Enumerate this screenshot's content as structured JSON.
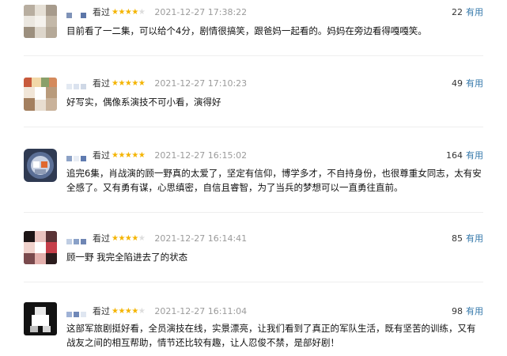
{
  "ui": {
    "watched_label": "看过",
    "useful_label": "有用"
  },
  "colors": {
    "star": "#f4b400",
    "star_off": "#dddddd",
    "useful_link": "#3377aa",
    "time": "#9b9b9b"
  },
  "reviews": [
    {
      "rating": 4,
      "time": "2021-12-27 17:38:22",
      "votes": "22",
      "content": "目前看了一二集，可以给个4分，剧情很搞笑，跟爸妈一起看的。妈妈在旁边看得嘎嘎笑。"
    },
    {
      "rating": 5,
      "time": "2021-12-27 17:10:23",
      "votes": "49",
      "content": "好写实，偶像系演技不可小看，演得好"
    },
    {
      "rating": 5,
      "time": "2021-12-27 16:15:02",
      "votes": "164",
      "content": "追完6集，肖战演的顾一野真的太爱了，坚定有信仰，博学多才，不自持身份，也很尊重女同志，太有安全感了。又有勇有谋，心思缜密，自信且睿智，为了当兵的梦想可以一直勇往直前。"
    },
    {
      "rating": 4,
      "time": "2021-12-27 16:14:41",
      "votes": "85",
      "content": "顾一野 我完全陷进去了的状态"
    },
    {
      "rating": 4,
      "time": "2021-12-27 16:11:04",
      "votes": "98",
      "content": "这部军旅剧挺好看，全员演技在线，实景漂亮，让我们看到了真正的军队生活，既有坚苦的训练，又有战友之间的相互帮助，情节还比较有趣，让人忍俊不禁，是部好剧！"
    }
  ]
}
